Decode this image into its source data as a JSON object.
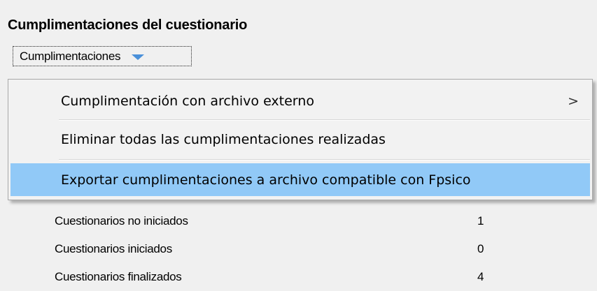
{
  "section": {
    "title": "Cumplimentaciones del cuestionario"
  },
  "dropdown": {
    "label": "Cumplimentaciones",
    "arrow_icon": "chevron-down-icon",
    "arrow_color": "#4a90d9"
  },
  "menu": {
    "items": [
      {
        "label": "Cumplimentación con archivo externo",
        "has_submenu": true,
        "submenu_glyph": ">"
      },
      {
        "label": "Eliminar todas las cumplimentaciones realizadas",
        "has_submenu": false
      },
      {
        "label": "Exportar cumplimentaciones a archivo compatible con Fpsico",
        "has_submenu": false,
        "highlighted": true
      }
    ],
    "highlight_color": "#91c9f7"
  },
  "stats": {
    "rows": [
      {
        "label": "Cuestionarios no iniciados",
        "value": "1"
      },
      {
        "label": "Cuestionarios iniciados",
        "value": "0"
      },
      {
        "label": "Cuestionarios finalizados",
        "value": "4"
      }
    ]
  }
}
